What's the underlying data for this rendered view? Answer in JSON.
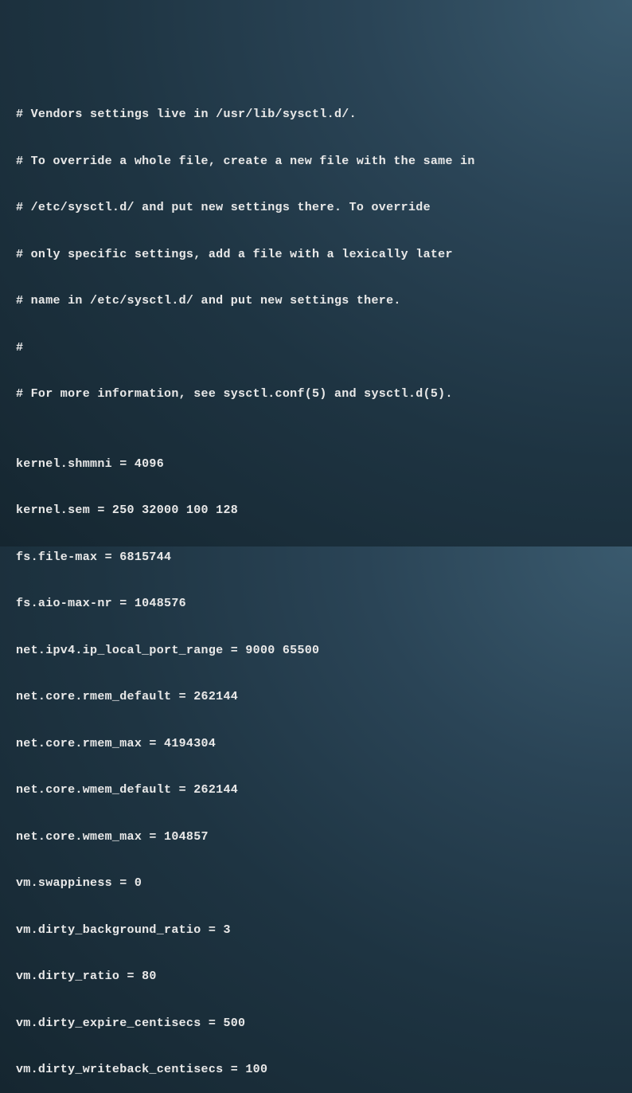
{
  "lines": [
    "# Vendors settings live in /usr/lib/sysctl.d/.",
    "# To override a whole file, create a new file with the same in",
    "# /etc/sysctl.d/ and put new settings there. To override",
    "# only specific settings, add a file with a lexically later",
    "# name in /etc/sysctl.d/ and put new settings there.",
    "#",
    "# For more information, see sysctl.conf(5) and sysctl.d(5).",
    "",
    "kernel.shmmni = 4096",
    "kernel.sem = 250 32000 100 128",
    "fs.file-max = 6815744",
    "fs.aio-max-nr = 1048576",
    "net.ipv4.ip_local_port_range = 9000 65500",
    "net.core.rmem_default = 262144",
    "net.core.rmem_max = 4194304",
    "net.core.wmem_default = 262144",
    "net.core.wmem_max = 104857",
    "vm.swappiness = 0",
    "vm.dirty_background_ratio = 3",
    "vm.dirty_ratio = 80",
    "vm.dirty_expire_centisecs = 500",
    "vm.dirty_writeback_centisecs = 100"
  ]
}
